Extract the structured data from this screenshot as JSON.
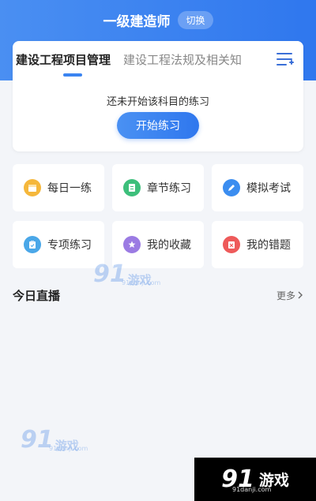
{
  "header": {
    "title": "一级建造师",
    "switch_label": "切换"
  },
  "tabs": {
    "active": "建设工程项目管理",
    "next": "建设工程法规及相关知"
  },
  "practice": {
    "hint": "还未开始该科目的练习",
    "start_label": "开始练习"
  },
  "grid": [
    {
      "label": "每日一练",
      "icon": "daily-icon",
      "color": "#f5b73b"
    },
    {
      "label": "章节练习",
      "icon": "chapter-icon",
      "color": "#3dbf7b"
    },
    {
      "label": "模拟考试",
      "icon": "pencil-icon",
      "color": "#3b8df0"
    },
    {
      "label": "专项练习",
      "icon": "clipboard-icon",
      "color": "#4aa7e8"
    },
    {
      "label": "我的收藏",
      "icon": "star-icon",
      "color": "#9b7be3"
    },
    {
      "label": "我的错题",
      "icon": "wrong-icon",
      "color": "#ee5a5a"
    }
  ],
  "live": {
    "title": "今日直播",
    "more": "更多"
  },
  "watermark": {
    "num": "91",
    "name": "游戏",
    "site": "91danji.com"
  }
}
